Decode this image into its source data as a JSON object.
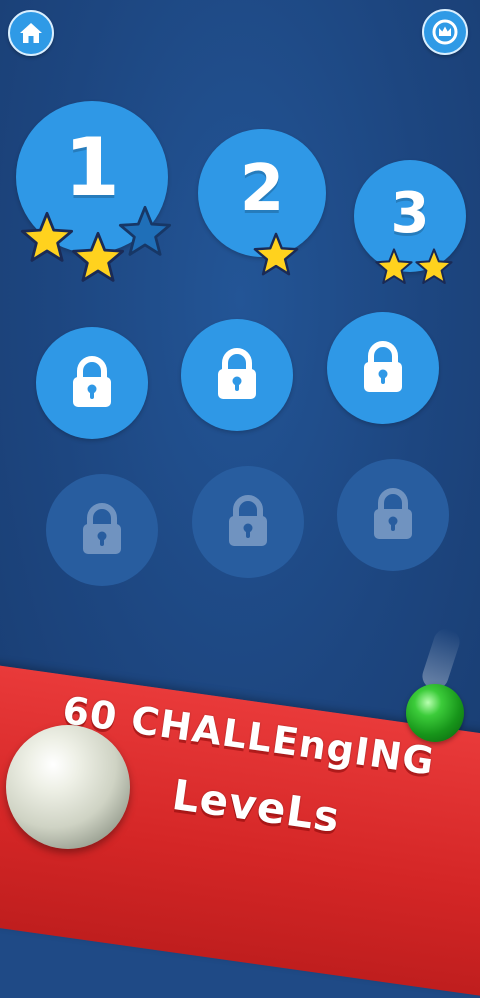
{
  "header": {
    "home_icon": "home-icon",
    "crown_icon": "crown-icon"
  },
  "levels": [
    {
      "number": "1",
      "stars_earned": 2,
      "stars_total": 3,
      "locked": false
    },
    {
      "number": "2",
      "stars_earned": 1,
      "stars_total": 1,
      "locked": false
    },
    {
      "number": "3",
      "stars_earned": 2,
      "stars_total": 2,
      "locked": false
    },
    {
      "number": "",
      "locked": true,
      "state": "available-locked"
    },
    {
      "number": "",
      "locked": true,
      "state": "available-locked"
    },
    {
      "number": "",
      "locked": true,
      "state": "available-locked"
    },
    {
      "number": "",
      "locked": true,
      "state": "faded-locked"
    },
    {
      "number": "",
      "locked": true,
      "state": "faded-locked"
    },
    {
      "number": "",
      "locked": true,
      "state": "faded-locked"
    }
  ],
  "promo": {
    "line1": "60 CHALLEngING",
    "line2": "LeveLs"
  },
  "colors": {
    "background": "#1f4a86",
    "level_button": "#2f98e6",
    "level_faded": "#285d9f",
    "star_gold": "#ffd21e",
    "star_empty": "#1f6fb8",
    "banner_red": "#d42626"
  }
}
